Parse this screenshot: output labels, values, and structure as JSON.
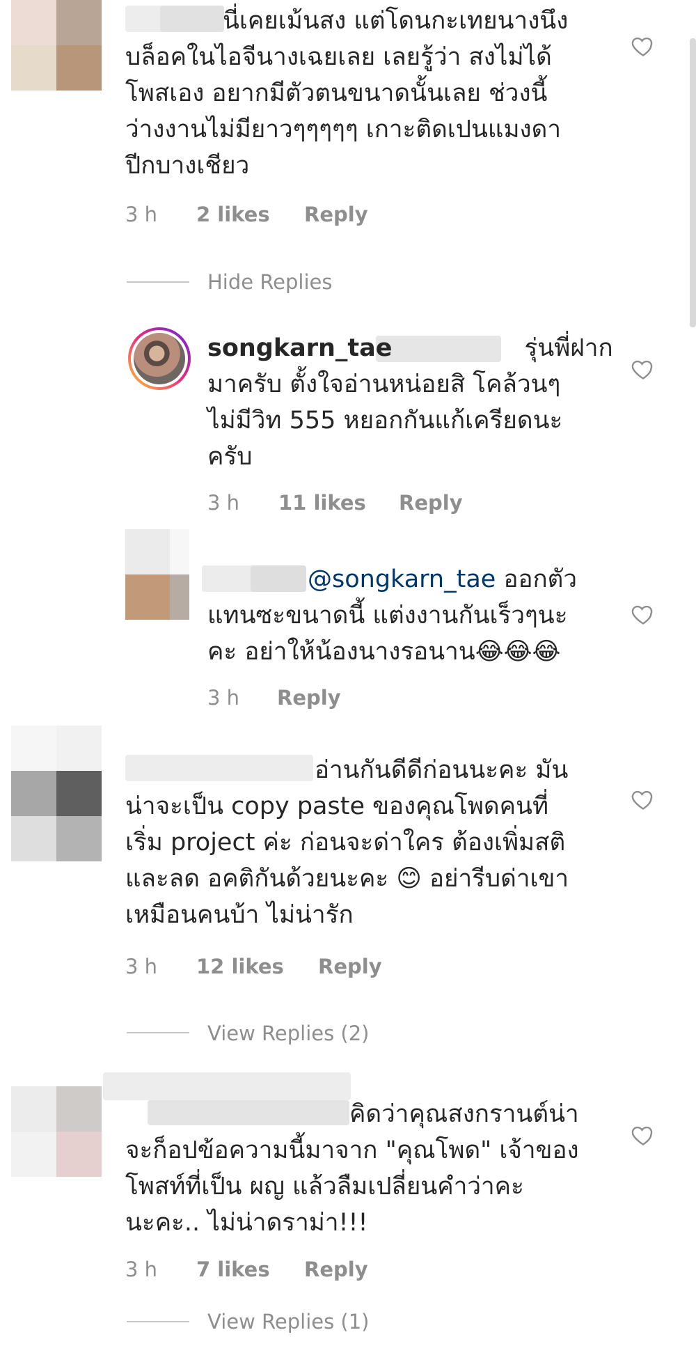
{
  "comments": [
    {
      "lines": [
        "นี่เคยเม้นสง แต่โดนกะเทยนางนึง",
        "บล็อคในไอจีนางเฉยเลย  เลยรู้ว่า สงไม่ได้",
        "โพสเอง อยากมีตัวตนขนาดนั้นเลย ช่วงนี้",
        "ว่างงานไม่มียาวๆๆๆๆๆ เกาะติดเปนแมงดา",
        "ปีกบางเชียว"
      ],
      "time": "3 h",
      "likes": "2 likes",
      "reply": "Reply",
      "replies_toggle": "Hide Replies"
    },
    {
      "username": "songkarn_tae",
      "lines": [
        "รุ่นพี่ฝาก",
        "มาครับ ตั้งใจอ่านหน่อยสิ โคล้วนๆ",
        "ไม่มีวิท 555 หยอกกันแก้เครียดนะ",
        "ครับ"
      ],
      "time": "3 h",
      "likes": "11 likes",
      "reply": "Reply"
    },
    {
      "mention": "@songkarn_tae",
      "lines": [
        "ออกตัว",
        "แทนซะขนาดนี้ แต่งงานกันเร็วๆนะ",
        "คะ อย่าให้น้องนางรอนาน😂😂😂"
      ],
      "time": "3 h",
      "reply": "Reply"
    },
    {
      "lines": [
        "อ่านกันดีดีก่อนนะคะ มัน",
        "น่าจะเป็น copy paste ของคุณโพดคนที่",
        "เริ่ม project ค่ะ ก่อนจะด่าใคร ต้องเพิ่มสติ",
        "และลด อคติกันด้วยนะคะ 😊 อย่ารีบด่าเขา",
        "เหมือนคนบ้า ไม่น่ารัก"
      ],
      "time": "3 h",
      "likes": "12 likes",
      "reply": "Reply",
      "replies_toggle": "View Replies (2)"
    },
    {
      "lines": [
        "คิดว่าคุณสงกรานต์น่า",
        "จะก็อปข้อความนี้มาจาก \"คุณโพด\" เจ้าของ",
        "โพสท์ที่เป็น ผญ แล้วลืมเปลี่ยนคำว่าคะ",
        "นะคะ.. ไม่น่าดราม่า!!!"
      ],
      "time": "3 h",
      "likes": "7 likes",
      "reply": "Reply",
      "replies_toggle": "View Replies (1)"
    }
  ],
  "icons": {
    "like": "heart-outline-icon"
  }
}
